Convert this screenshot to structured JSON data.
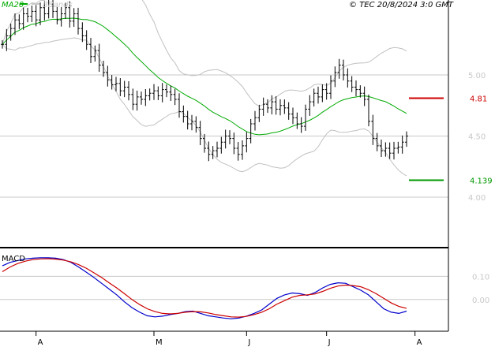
{
  "chart_data": [
    {
      "type": "line",
      "panel": "price",
      "legend": [
        "MA20",
        "BBands"
      ],
      "copyright": "© TEC 20/8/2024 3:0 GMT",
      "ylim": [
        3.6,
        5.6
      ],
      "yticks": [
        {
          "value": 4.0,
          "label": "4.00"
        },
        {
          "value": 4.5,
          "label": "4.50"
        },
        {
          "value": 5.0,
          "label": "5.00"
        }
      ],
      "x_months": [
        "A",
        "M",
        "J",
        "J",
        "A"
      ],
      "month_start_index": [
        8,
        36,
        58,
        77,
        98
      ],
      "price_levels": [
        {
          "name": "resistance",
          "value": 4.81,
          "label": "4.81",
          "color": "#cc0000"
        },
        {
          "name": "support",
          "value": 4.139,
          "label": "4.139",
          "color": "#009900"
        }
      ],
      "close": [
        5.25,
        5.32,
        5.38,
        5.45,
        5.42,
        5.5,
        5.48,
        5.52,
        5.45,
        5.55,
        5.5,
        5.58,
        5.52,
        5.45,
        5.5,
        5.55,
        5.44,
        5.5,
        5.38,
        5.32,
        5.25,
        5.15,
        5.2,
        5.08,
        5.02,
        4.96,
        4.92,
        4.93,
        4.87,
        4.9,
        4.84,
        4.76,
        4.82,
        4.8,
        4.83,
        4.85,
        4.87,
        4.83,
        4.88,
        4.86,
        4.84,
        4.8,
        4.7,
        4.66,
        4.6,
        4.62,
        4.57,
        4.48,
        4.4,
        4.35,
        4.38,
        4.4,
        4.45,
        4.5,
        4.48,
        4.4,
        4.35,
        4.42,
        4.48,
        4.6,
        4.65,
        4.72,
        4.76,
        4.73,
        4.78,
        4.72,
        4.75,
        4.73,
        4.68,
        4.65,
        4.6,
        4.58,
        4.72,
        4.78,
        4.85,
        4.82,
        4.88,
        4.85,
        4.95,
        5.02,
        5.08,
        5.0,
        4.95,
        4.9,
        4.88,
        4.85,
        4.8,
        4.62,
        4.48,
        4.42,
        4.38,
        4.4,
        4.36,
        4.4,
        4.41,
        4.45,
        4.5
      ]
    },
    {
      "type": "line",
      "panel": "macd",
      "title": "MACD",
      "ylim": [
        -0.13,
        0.21
      ],
      "yticks": [
        {
          "value": 0.0,
          "label": "0.00"
        },
        {
          "value": 0.1,
          "label": "0.10"
        }
      ],
      "series": [
        {
          "name": "macd",
          "color": "#0000cc",
          "values": [
            0.145,
            0.16,
            0.168,
            0.175,
            0.178,
            0.18,
            0.18,
            0.178,
            0.172,
            0.16,
            0.14,
            0.118,
            0.095,
            0.07,
            0.045,
            0.02,
            -0.01,
            -0.035,
            -0.055,
            -0.07,
            -0.075,
            -0.072,
            -0.065,
            -0.06,
            -0.052,
            -0.05,
            -0.06,
            -0.07,
            -0.075,
            -0.08,
            -0.083,
            -0.08,
            -0.072,
            -0.06,
            -0.045,
            -0.02,
            0.005,
            0.02,
            0.028,
            0.025,
            0.018,
            0.03,
            0.05,
            0.065,
            0.072,
            0.07,
            0.055,
            0.04,
            0.02,
            -0.01,
            -0.04,
            -0.055,
            -0.06,
            -0.05
          ]
        },
        {
          "name": "signal",
          "color": "#cc0000",
          "values": [
            0.12,
            0.14,
            0.155,
            0.165,
            0.172,
            0.175,
            0.176,
            0.174,
            0.17,
            0.162,
            0.15,
            0.135,
            0.115,
            0.095,
            0.072,
            0.05,
            0.025,
            0.0,
            -0.022,
            -0.04,
            -0.052,
            -0.06,
            -0.062,
            -0.06,
            -0.055,
            -0.052,
            -0.053,
            -0.058,
            -0.065,
            -0.07,
            -0.075,
            -0.076,
            -0.073,
            -0.065,
            -0.055,
            -0.04,
            -0.02,
            -0.005,
            0.01,
            0.018,
            0.02,
            0.024,
            0.035,
            0.048,
            0.058,
            0.062,
            0.06,
            0.055,
            0.042,
            0.025,
            0.005,
            -0.015,
            -0.03,
            -0.038
          ]
        }
      ]
    }
  ]
}
